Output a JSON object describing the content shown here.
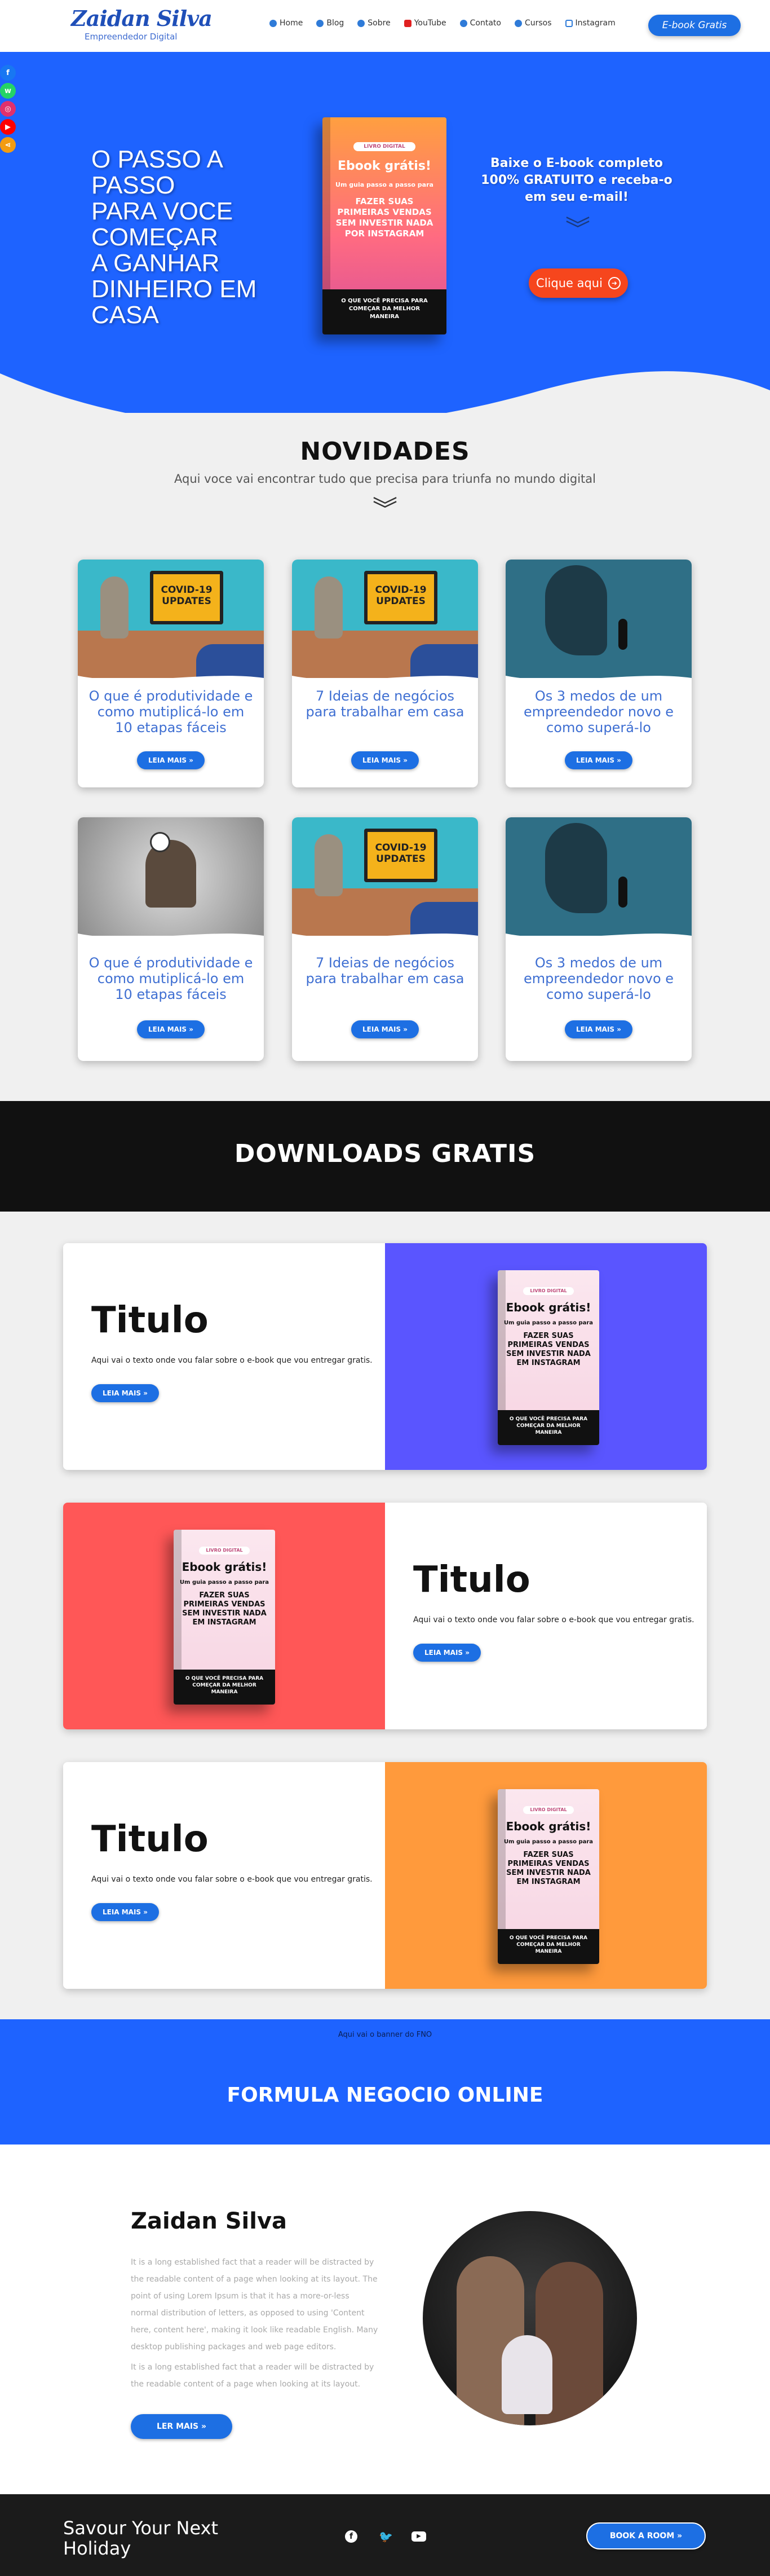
{
  "header": {
    "logo": "Zaidan Silva",
    "logo_sub": "Empreendedor Digital",
    "nav": [
      "Home",
      "Blog",
      "Sobre",
      "YouTube",
      "Contato",
      "Cursos",
      "Instagram"
    ],
    "cta": "E-book Gratis"
  },
  "hero": {
    "title_lines": [
      "O PASSO A PASSO",
      "PARA VOCE",
      "COMEÇAR",
      "A GANHAR",
      "DINHEIRO EM",
      "CASA"
    ],
    "subtitle": "Baixe o E-book completo 100% GRATUITO e receba-o em seu e-mail!",
    "button": "Clique aqui",
    "book": {
      "badge": "LIVRO DIGITAL",
      "title": "Ebook grátis!",
      "sub": "Um guia passo a passo para",
      "main": "FAZER SUAS PRIMEIRAS VENDAS SEM INVESTIR NADA POR INSTAGRAM",
      "footer": "O QUE VOCÊ PRECISA PARA COMEÇAR DA MELHOR MANEIRA"
    }
  },
  "novidades": {
    "title": "NOVIDADES",
    "subtitle": "Aqui voce vai encontrar tudo que precisa para triunfa no mundo digital",
    "cards": [
      {
        "title": "O que é produtividade e como mutiplicá-lo em 10 etapas fáceis",
        "button": "LEIA MAIS"
      },
      {
        "title": "7 Ideias de negócios para trabalhar em casa",
        "button": "LEIA MAIS"
      },
      {
        "title": "Os 3 medos de um empreendedor novo e como superá-lo",
        "button": "LEIA MAIS"
      },
      {
        "title": "O que é produtividade e como mutiplicá-lo em 10 etapas fáceis",
        "button": "LEIA MAIS"
      },
      {
        "title": "7 Ideias de negócios para trabalhar em casa",
        "button": "LEIA MAIS"
      },
      {
        "title": "Os 3 medos de um empreendedor novo e como superá-lo",
        "button": "LEIA MAIS"
      }
    ],
    "covid_sign": "COVID-19 UPDATES"
  },
  "downloads": {
    "title": "DOWNLOADS GRATIS",
    "items": [
      {
        "title": "Titulo",
        "text": "Aqui vai o texto onde vou falar sobre o e-book que vou entregar gratis.",
        "button": "LEIA MAIS",
        "color": "#5a55ff"
      },
      {
        "title": "Titulo",
        "text": "Aqui vai o texto onde vou falar sobre o e-book que vou entregar gratis.",
        "button": "LEIA MAIS",
        "color": "#ff5757"
      },
      {
        "title": "Titulo",
        "text": "Aqui vai o texto onde vou falar sobre o e-book que vou entregar gratis.",
        "button": "LEIA MAIS",
        "color": "#ff9a3c"
      }
    ],
    "book": {
      "badge": "LIVRO DIGITAL",
      "title": "Ebook grátis!",
      "sub": "Um guia passo a passo para",
      "main": "FAZER SUAS PRIMEIRAS VENDAS SEM INVESTIR NADA EM INSTAGRAM",
      "footer": "O QUE VOCÊ PRECISA PARA COMEÇAR DA MELHOR MANEIRA"
    }
  },
  "banner": {
    "small": "Aqui vai o banner do FNO",
    "title": "FORMULA NEGOCIO ONLINE"
  },
  "profile": {
    "name": "Zaidan Silva",
    "p1": "It is a long established fact that a reader will be distracted by the readable content of a page when looking at its layout. The point of using Lorem Ipsum is that it has a more-or-less normal distribution of letters, as opposed to using 'Content here, content here', making it look like readable English. Many desktop publishing packages and web page editors.",
    "p2": "It is a long established fact that a reader will be distracted by the readable content of a page when looking at its layout.",
    "button": "LER MAIS"
  },
  "footer": {
    "tagline": "Savour Your Next Holiday",
    "button": "BOOK A ROOM"
  }
}
